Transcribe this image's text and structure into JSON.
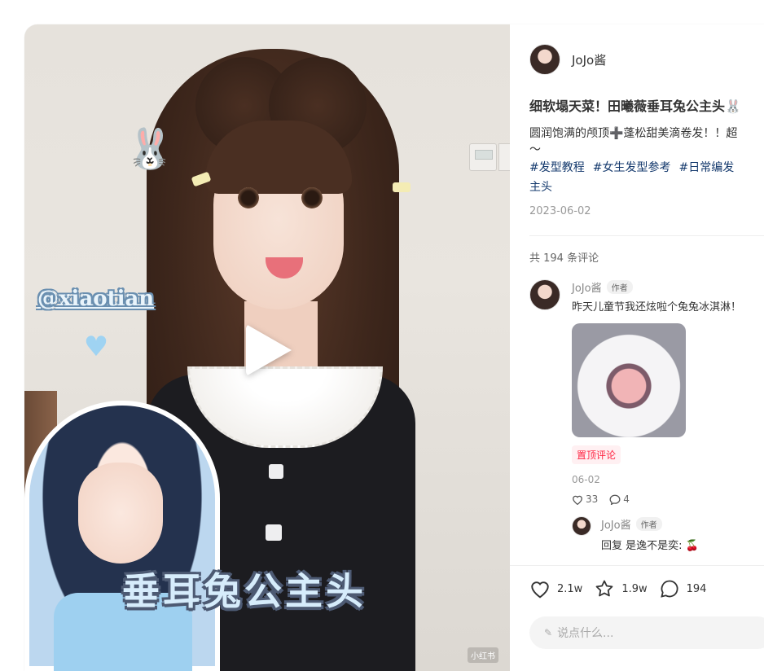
{
  "media": {
    "handle": "@xiaotian",
    "title_overlay": "垂耳兔公主头",
    "watermark": "小红书",
    "icons": {
      "play": "play-icon",
      "rabbit": "rabbit-emoji",
      "heart": "heart-emoji"
    }
  },
  "author": {
    "name": "JoJo酱"
  },
  "note": {
    "title": "细软塌天菜！田曦薇垂耳兔公主头🐰",
    "desc_line1": "圆润饱满的颅顶➕蓬松甜美滴卷发！！超",
    "desc_line2": "～",
    "tags": [
      "#发型教程",
      "#女生发型参考",
      "#日常编发"
    ],
    "tags_line2": "主头",
    "date": "2023-06-02"
  },
  "comments": {
    "count_text": "共 194 条评论",
    "items": [
      {
        "author": "JoJo酱",
        "badge": "作者",
        "text": "昨天儿童节我还炫啦个兔兔冰淇淋！",
        "pinned_label": "置顶评论",
        "date": "06-02",
        "likes": "33",
        "replies": "4",
        "reply": {
          "author": "JoJo酱",
          "badge": "作者",
          "prefix": "回复",
          "text": " 是逸不是奕: 🍒"
        }
      }
    ]
  },
  "footer": {
    "likes": "2.1w",
    "collects": "1.9w",
    "comments": "194",
    "input_placeholder": "说点什么..."
  }
}
